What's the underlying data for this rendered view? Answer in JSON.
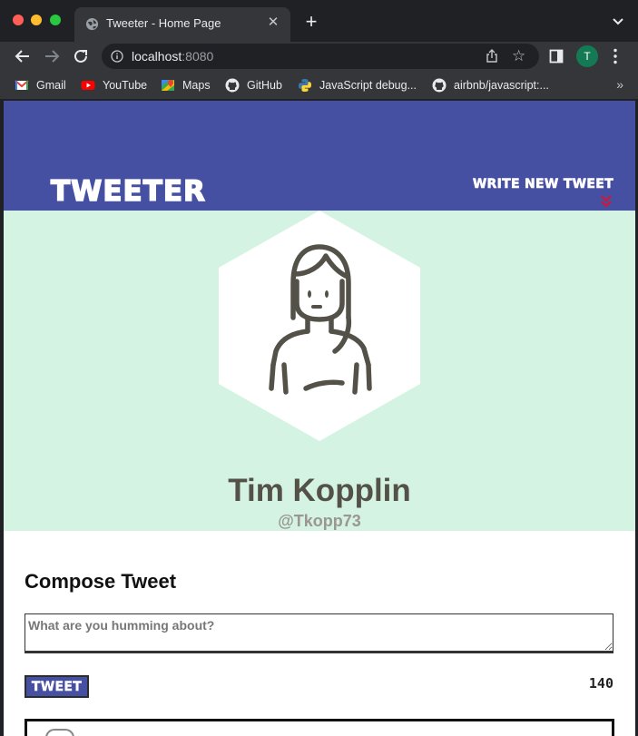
{
  "browser": {
    "tab": {
      "title": "Tweeter - Home Page",
      "close_icon": "close-icon",
      "favicon": "globe-icon"
    },
    "new_tab_symbol": "+",
    "url_host": "localhost",
    "url_port": ":8080",
    "profile_initial": "T",
    "profile_color": "#137a55",
    "bookmarks": [
      {
        "label": "Gmail",
        "icon": "gmail-icon"
      },
      {
        "label": "YouTube",
        "icon": "youtube-icon"
      },
      {
        "label": "Maps",
        "icon": "maps-icon"
      },
      {
        "label": "GitHub",
        "icon": "github-icon"
      },
      {
        "label": "JavaScript debug...",
        "icon": "python-icon"
      },
      {
        "label": "airbnb/javascript:...",
        "icon": "github-icon"
      }
    ],
    "bookmarks_overflow": "»"
  },
  "nav": {
    "brand": "Tweeter",
    "write_new": "Write new tweet",
    "background": "#4650a3"
  },
  "profile": {
    "name": "Tim Kopplin",
    "handle": "@Tkopp73",
    "background": "#d4f3e2"
  },
  "compose": {
    "title": "Compose Tweet",
    "placeholder": "What are you humming about?",
    "button": "Tweet",
    "counter": "140"
  }
}
